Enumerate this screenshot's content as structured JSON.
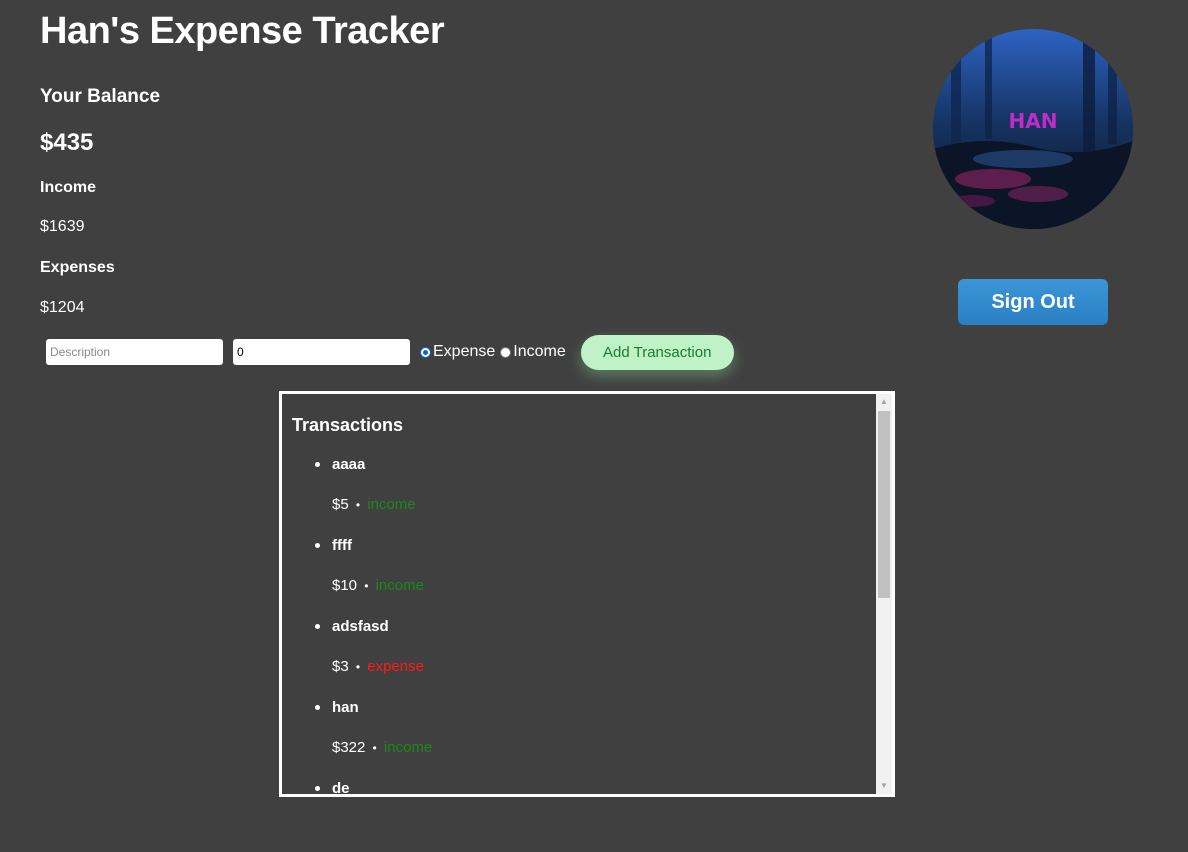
{
  "header": {
    "title": "Han's Expense Tracker"
  },
  "summary": {
    "balance_label": "Your Balance",
    "balance_value": "$435",
    "income_label": "Income",
    "income_value": "$1639",
    "expenses_label": "Expenses",
    "expenses_value": "$1204"
  },
  "form": {
    "description_placeholder": "Description",
    "amount_value": "0",
    "radio_options": [
      "Expense",
      "Income"
    ],
    "selected_type": "Expense",
    "add_button_label": "Add Transaction"
  },
  "user": {
    "avatar_text": "HAN",
    "sign_out_label": "Sign Out"
  },
  "transactions": {
    "title": "Transactions",
    "separator": "•",
    "items": [
      {
        "description": "aaaa",
        "amount": "$5",
        "type": "income"
      },
      {
        "description": "ffff",
        "amount": "$10",
        "type": "income"
      },
      {
        "description": "adsfasd",
        "amount": "$3",
        "type": "expense"
      },
      {
        "description": "han",
        "amount": "$322",
        "type": "income"
      },
      {
        "description": "de",
        "amount": "",
        "type": ""
      }
    ]
  },
  "colors": {
    "background": "#404040",
    "income": "#1a8a1a",
    "expense": "#ff1a1a",
    "sign_out": "#2a7fc2",
    "add_button": "#bff2c7"
  },
  "icons": {
    "scroll_up": "scroll-up-arrow-icon",
    "scroll_down": "scroll-down-arrow-icon"
  }
}
